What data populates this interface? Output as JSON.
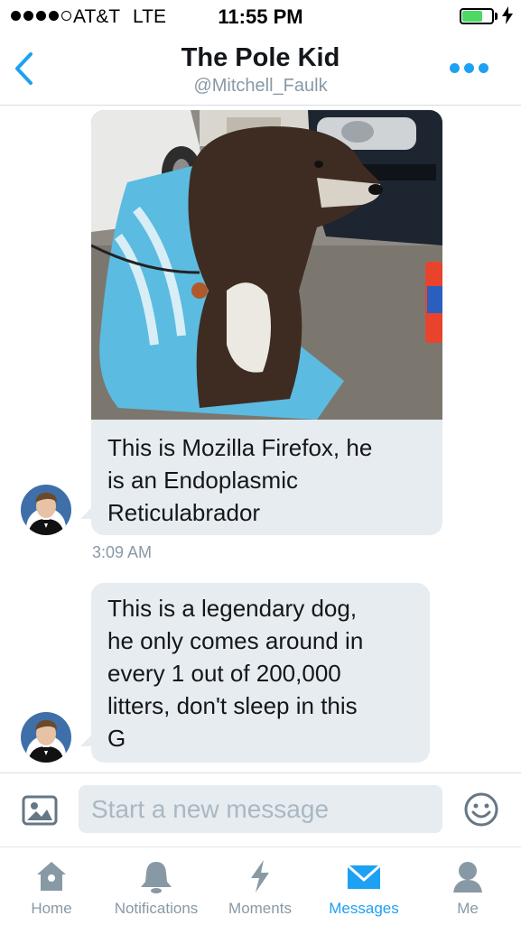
{
  "status_bar": {
    "carrier": "AT&T",
    "network": "LTE",
    "time": "11:55 PM",
    "signal_bars_filled": 4,
    "signal_bars_total": 5,
    "battery_level": 0.7
  },
  "header": {
    "title": "The Pole Kid",
    "handle": "@Mitchell_Faulk",
    "back_icon": "chevron-left-icon",
    "more_icon": "more-dots-icon"
  },
  "messages": [
    {
      "has_photo": true,
      "photo_description_icon": "dog-photo",
      "text": "This is Mozilla Firefox, he is an Endoplasmic Reticulabrador",
      "lines": [
        "This is Mozilla Firefox, he",
        "is an Endoplasmic",
        "Reticulabrador"
      ],
      "timestamp": "3:09 AM"
    },
    {
      "has_photo": false,
      "text": "This is a legendary dog, he only comes around in every 1 out of 200,000 litters, don't sleep in this G",
      "lines": [
        "This is a legendary dog,",
        "he only comes around in",
        "every 1 out of 200,000",
        "litters, don't sleep in this",
        "G"
      ]
    }
  ],
  "composer": {
    "placeholder": "Start a new message",
    "image_icon": "image-icon",
    "emoji_icon": "smiley-icon"
  },
  "tabs": [
    {
      "label": "Home",
      "icon": "home-icon",
      "active": false
    },
    {
      "label": "Notifications",
      "icon": "bell-icon",
      "active": false
    },
    {
      "label": "Moments",
      "icon": "lightning-icon",
      "active": false
    },
    {
      "label": "Messages",
      "icon": "envelope-icon",
      "active": true
    },
    {
      "label": "Me",
      "icon": "person-icon",
      "active": false
    }
  ],
  "colors": {
    "accent": "#1da1f2",
    "bubble": "#e6ecf0",
    "muted": "#8899a6",
    "text": "#14171a"
  }
}
